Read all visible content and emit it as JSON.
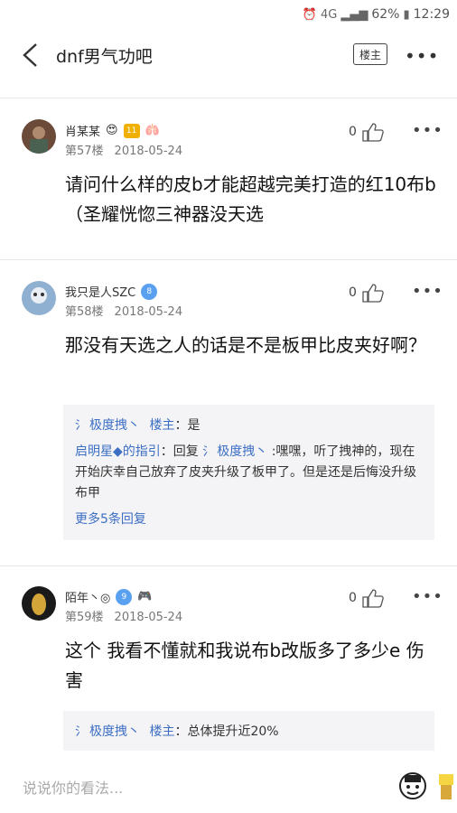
{
  "status_bar": {
    "battery": "62%",
    "time": "12:29",
    "network": "4G"
  },
  "nav": {
    "title": "dnf男气功吧",
    "louzhu_label": "楼主",
    "more": "•••"
  },
  "posts": [
    {
      "username": "肖某某",
      "badge": "11",
      "floor": "第57楼",
      "date": "2018-05-24",
      "likes": "0",
      "more": "•••",
      "content": "请问什么样的皮b才能超越完美打造的红10布b（圣耀恍惚三神器没天选"
    },
    {
      "username": "我只是人SZC",
      "badge": "8",
      "floor": "第58楼",
      "date": "2018-05-24",
      "likes": "0",
      "more": "•••",
      "content": "那没有天选之人的话是不是板甲比皮夹好啊？",
      "replies": [
        {
          "tag": "氵",
          "name": "极度拽丶",
          "louzhu": "楼主",
          "text": "：是"
        },
        {
          "name": "启明星◆的指引",
          "text": "：回复",
          "tag": "氵",
          "target": "极度拽丶",
          "text2": " :嘿嘿，听了拽神的，现在开始庆幸自己放弃了皮夹升级了板甲了。但是还是后悔没升级布甲"
        }
      ],
      "more_replies": "更多5条回复"
    },
    {
      "username": "陌年丶◎",
      "badge": "9",
      "floor": "第59楼",
      "date": "2018-05-24",
      "likes": "0",
      "more": "•••",
      "content": "这个 我看不懂就和我说布b改版多了多少e 伤害",
      "replies": [
        {
          "tag": "氵",
          "name": "极度拽丶",
          "louzhu": "楼主",
          "text": "：总体提升近20%"
        }
      ]
    }
  ],
  "bottom": {
    "input_placeholder": "说说你的看法..."
  },
  "colors": {
    "link_blue": "#3c6fc4",
    "reply_bg": "#f4f4f6"
  }
}
